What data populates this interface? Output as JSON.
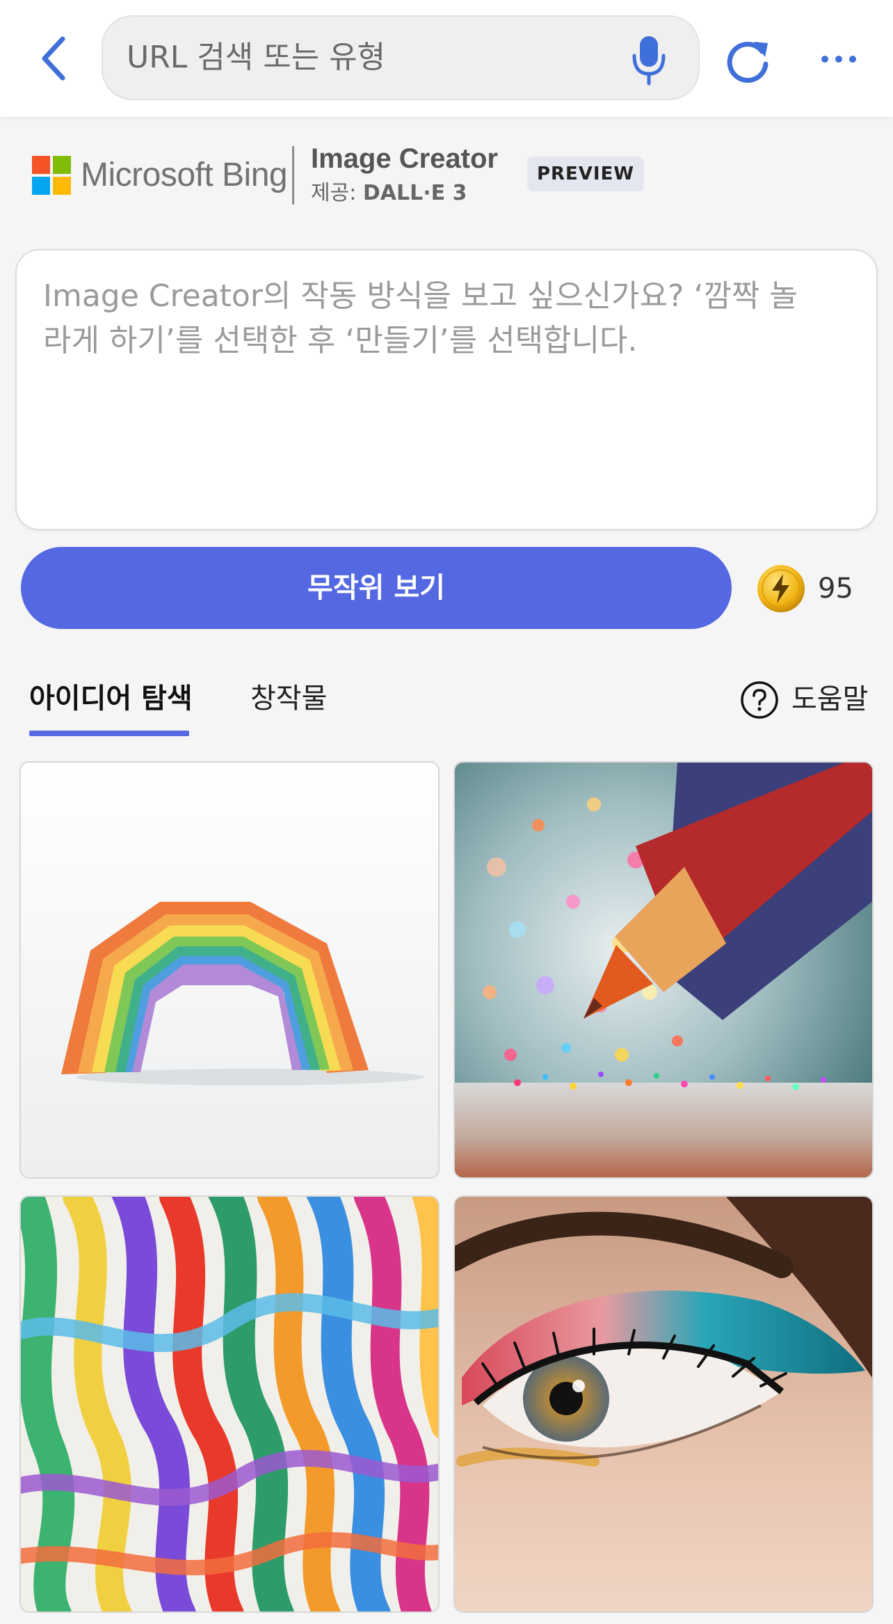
{
  "browser": {
    "url_placeholder": "URL 검색 또는 유형",
    "icons": [
      "back-chevron-icon",
      "microphone-icon",
      "refresh-icon",
      "more-icon"
    ],
    "accent_color": "#3f6fd8"
  },
  "header": {
    "brand": "Microsoft Bing",
    "product": "Image Creator",
    "powered_by_prefix": "제공: ",
    "powered_by_model": "DALL·E 3",
    "badge": "PREVIEW"
  },
  "prompt": {
    "placeholder": "Image Creator의 작동 방식을 보고 싶으신가요? ‘깜짝 놀라게 하기’를 선택한 후 ‘만들기’를 선택합니다."
  },
  "actions": {
    "surprise_label": "무작위 보기",
    "boost_count": "95",
    "button_color": "#5468e2"
  },
  "tabs": {
    "ideas": "아이디어 탐색",
    "creations": "창작물",
    "help": "도움말"
  },
  "gallery": {
    "images": [
      {
        "subject": "paper rainbow arch"
      },
      {
        "subject": "colored pencil with glitter"
      },
      {
        "subject": "colorful paper ribbons"
      },
      {
        "subject": "eye with rainbow eyeshadow"
      }
    ]
  }
}
